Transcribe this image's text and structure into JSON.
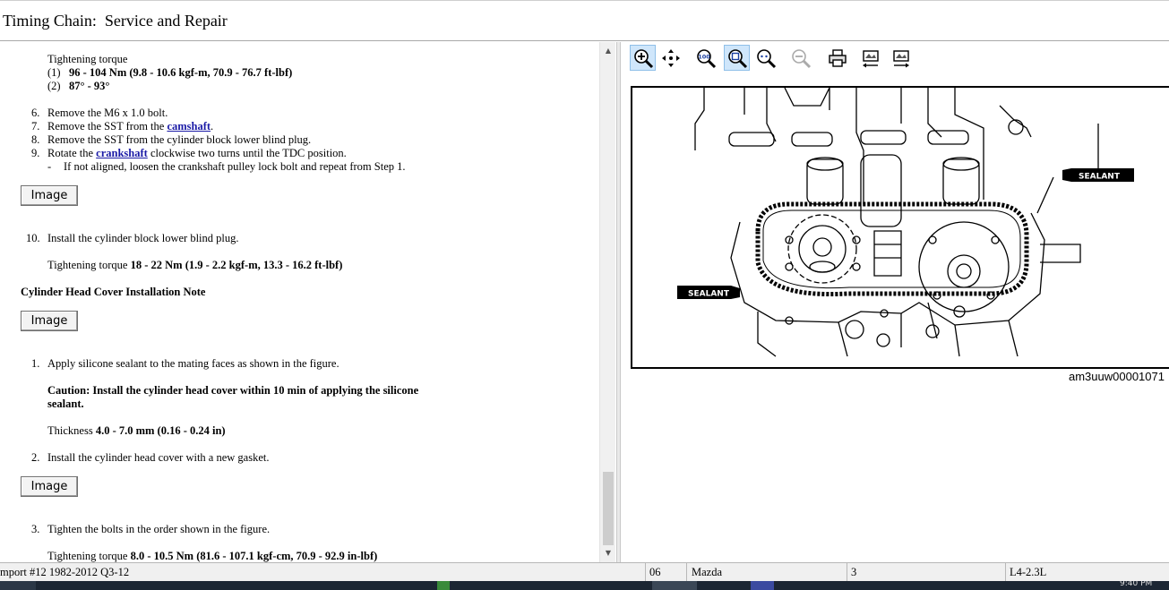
{
  "window": {
    "title": "Timing Chain:  Service and Repair"
  },
  "content": {
    "torque_heading": "Tightening torque",
    "torque_items": [
      {
        "num": "(1)",
        "value": "96 - 104 Nm (9.8 - 10.6 kgf-m, 70.9 - 76.7 ft-lbf)"
      },
      {
        "num": "(2)",
        "value": "87° - 93°"
      }
    ],
    "steps_a": [
      {
        "num": "6.",
        "text": "Remove the M6 x 1.0 bolt."
      },
      {
        "num": "7.",
        "pre": "Remove the SST from the ",
        "link": "camshaft",
        "post": "."
      },
      {
        "num": "8.",
        "text": "Remove the SST from the cylinder block lower blind plug."
      },
      {
        "num": "9.",
        "pre": "Rotate the ",
        "link": "crankshaft",
        "post": " clockwise two turns until the TDC position."
      }
    ],
    "sub_bullet": {
      "dash": "-",
      "text": "If not aligned, loosen the crankshaft pulley lock bolt and repeat from Step 1."
    },
    "image_button_label": "Image",
    "step10": {
      "num": "10.",
      "text": "Install the cylinder block lower blind plug."
    },
    "torque10": {
      "label": "Tightening torque ",
      "value": "18 - 22 Nm (1.9 - 2.2 kgf-m, 13.3 - 16.2 ft-lbf)"
    },
    "section_heading": "Cylinder Head Cover Installation Note",
    "step1": {
      "num": "1.",
      "text": "Apply silicone sealant to the mating faces as shown in the figure."
    },
    "caution_line1": "Caution: Install the cylinder head cover within 10 min of applying the silicone",
    "caution_line2": "sealant.",
    "thickness": {
      "label": "Thickness ",
      "value": "4.0 - 7.0 mm (0.16 - 0.24 in)"
    },
    "step2": {
      "num": "2.",
      "text": "Install the cylinder head cover with a new gasket."
    },
    "step3": {
      "num": "3.",
      "text": "Tighten the bolts in the order shown in the figure."
    },
    "torque3": {
      "label": "Tightening torque ",
      "value": "8.0 - 10.5 Nm (81.6 - 107.1 kgf-cm, 70.9 - 92.9 in-lbf)"
    }
  },
  "viewer": {
    "toolbar": [
      {
        "name": "zoom-in-icon",
        "active": true
      },
      {
        "name": "pan-icon",
        "active": false
      },
      {
        "name": "zoom-100-icon",
        "active": false
      },
      {
        "name": "zoom-fit-icon",
        "active": true
      },
      {
        "name": "zoom-out-icon",
        "active": false
      },
      {
        "name": "zoom-out-disabled-icon",
        "active": false
      },
      {
        "name": "print-icon",
        "active": false
      },
      {
        "name": "previous-image-icon",
        "active": false
      },
      {
        "name": "next-image-icon",
        "active": false
      }
    ],
    "figure_labels": {
      "sealant_right": "SEALANT",
      "sealant_left": "SEALANT"
    },
    "caption": "am3uuw00001071"
  },
  "status": {
    "source": "mport #12 1982-2012 Q3-12",
    "year": "06",
    "make": "Mazda",
    "model": "3",
    "engine": "L4-2.3L"
  },
  "taskbar": {
    "clock": "9:40 PM"
  },
  "colors": {
    "link": "#1a1aa6",
    "toolbar_active": "#cfe6fb",
    "taskbar": "#1c2633"
  }
}
